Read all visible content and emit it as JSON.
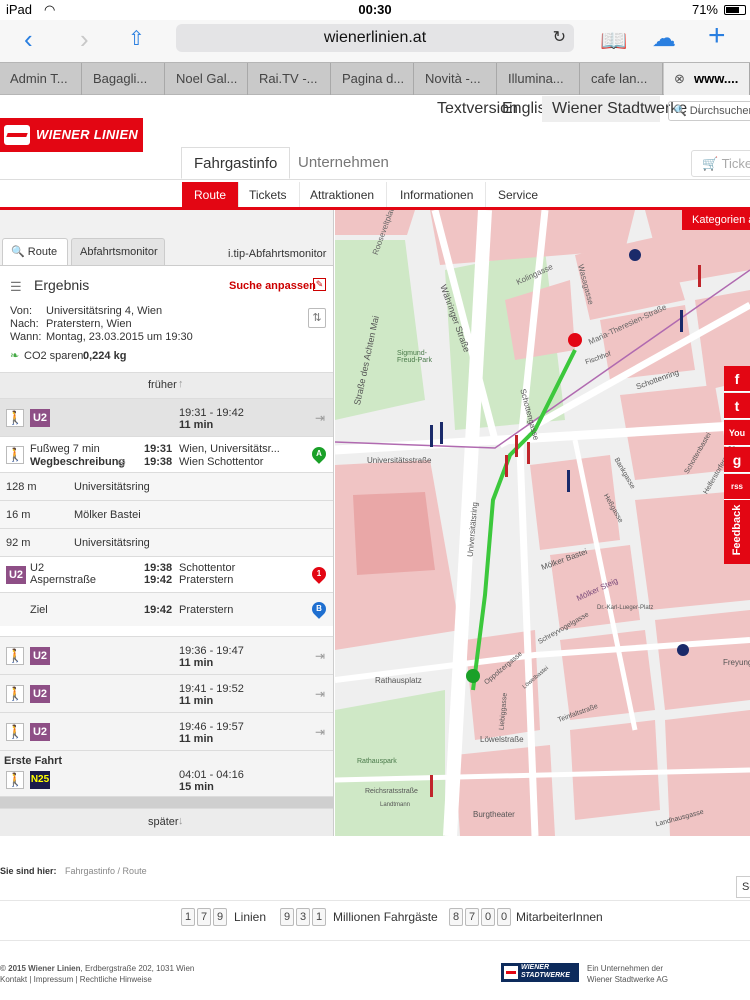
{
  "status_bar": {
    "device": "iPad",
    "time": "00:30",
    "battery": "71%",
    "battery_level": 0.71
  },
  "browser": {
    "url": "wienerlinien.at",
    "tabs": [
      "Admin T...",
      "Bagagli...",
      "Noel Gal...",
      "Rai.TV -...",
      "Pagina d...",
      "Novità -...",
      "Illumina...",
      "cafe lan...",
      "www...."
    ]
  },
  "site": {
    "logo_text": "WIENER LINIEN",
    "top_nav": [
      "Textversion",
      "English",
      "Wiener Stadtwerke"
    ],
    "search_placeholder": "Durchsuchen...",
    "main_tabs": [
      "Fahrgastinfo",
      "Unternehmen"
    ],
    "cart_label": "Ticke",
    "sub_nav": [
      "Route",
      "Tickets",
      "Attraktionen",
      "Informationen",
      "Service"
    ]
  },
  "panel": {
    "tabs": {
      "route": "Route",
      "abfahrt": "Abfahrtsmonitor",
      "itip": "i.tip-Abfahrtsmonitor"
    },
    "ergebnis": "Ergebnis",
    "suche_anpassen": "Suche anpassen",
    "von_label": "Von:",
    "von": "Universitätsring 4, Wien",
    "nach_label": "Nach:",
    "nach": "Praterstern, Wien",
    "wann_label": "Wann:",
    "wann": "Montag, 23.03.2015 um 19:30",
    "co2_label": "CO2 sparen:",
    "co2_value": "0,224 kg",
    "frueher": "früher",
    "spaeter": "später",
    "first_trip": {
      "line": "U2",
      "time": "19:31 - 19:42",
      "duration": "11 min"
    },
    "walk_step": {
      "title": "Fußweg 7 min",
      "sub": "Wegbeschreibung",
      "t1": "19:31",
      "t2": "19:38",
      "place1": "Wien, Universitätsr...",
      "place2": "Wien Schottentor"
    },
    "walk_segments": [
      {
        "dist": "128 m",
        "street": "Universitätsring"
      },
      {
        "dist": "16 m",
        "street": "Mölker Bastei"
      },
      {
        "dist": "92 m",
        "street": "Universitätsring"
      }
    ],
    "ride_step": {
      "line": "U2",
      "direction": "Aspernstraße",
      "t1": "19:38",
      "t2": "19:42",
      "stop1": "Schottentor",
      "stop2": "Praterstern"
    },
    "ziel": {
      "label": "Ziel",
      "time": "19:42",
      "place": "Praterstern"
    },
    "more_trips": [
      {
        "line": "U2",
        "time": "19:36 - 19:47",
        "duration": "11 min"
      },
      {
        "line": "U2",
        "time": "19:41 - 19:52",
        "duration": "11 min"
      },
      {
        "line": "U2",
        "time": "19:46 - 19:57",
        "duration": "11 min"
      }
    ],
    "erste_fahrt": {
      "label": "Erste Fahrt",
      "line": "N25",
      "time": "04:01 - 04:16",
      "duration": "15 min"
    }
  },
  "map": {
    "kategorien": "Kategorien a",
    "streets": [
      "Rooseveltplatz",
      "Währinger Straße",
      "Straße des Achten Mai",
      "Sigmund-Freud-Park",
      "Kolingasse",
      "Wasagasse",
      "Maria-Theresien-Straße",
      "Schottengasse",
      "Schottenring",
      "Universitätsstraße",
      "Universitätsring",
      "Rathausplatz",
      "Mölker Bastei",
      "Mölker Steig",
      "Schreyvogelgasse",
      "Oppolzergasse",
      "Teinfaltstraße",
      "Löwelstraße",
      "Rathauspark",
      "Burgtheater",
      "Landhausgasse",
      "Freyung",
      "Schottenbastei",
      "Helferstorferstraße",
      "Heßgasse",
      "Liebiggasse",
      "Reichsratsstraße",
      "Bankgasse",
      "Fischhof",
      "Dr.-Karl-Lueger-Platz",
      "Löwelbastei",
      "Landtmann"
    ],
    "social": [
      "f",
      "t",
      "You",
      "g",
      "rss"
    ],
    "feedback": "Feedback"
  },
  "footer": {
    "sie_sind_hier": "Sie sind hier:",
    "breadcrumb": "Fahrgastinfo / Route",
    "search_btn": "Se",
    "counters": [
      {
        "digits": [
          "1",
          "7",
          "9"
        ],
        "label": "Linien"
      },
      {
        "digits": [
          "9",
          "3",
          "1"
        ],
        "label": "Millionen Fahrgäste"
      },
      {
        "digits": [
          "8",
          "7",
          "0",
          "0"
        ],
        "label": "MitarbeiterInnen"
      }
    ],
    "copyright_bold": "© 2015 Wiener Linien",
    "copyright_rest": ", Erdbergstraße 202, 1031 Wien",
    "links": [
      "Kontakt",
      "Impressum",
      "Rechtliche Hinweise"
    ],
    "stadtwerke_logo": "WIENER STADTWERKE",
    "unternehmen_1": "Ein Unternehmen der",
    "unternehmen_2": "Wiener Stadtwerke AG"
  },
  "colors": {
    "accent": "#e30613",
    "u2": "#8e4f86",
    "route_green": "#3cc83c",
    "pin_green": "#1aa028",
    "pin_blue": "#1f6fd0"
  }
}
